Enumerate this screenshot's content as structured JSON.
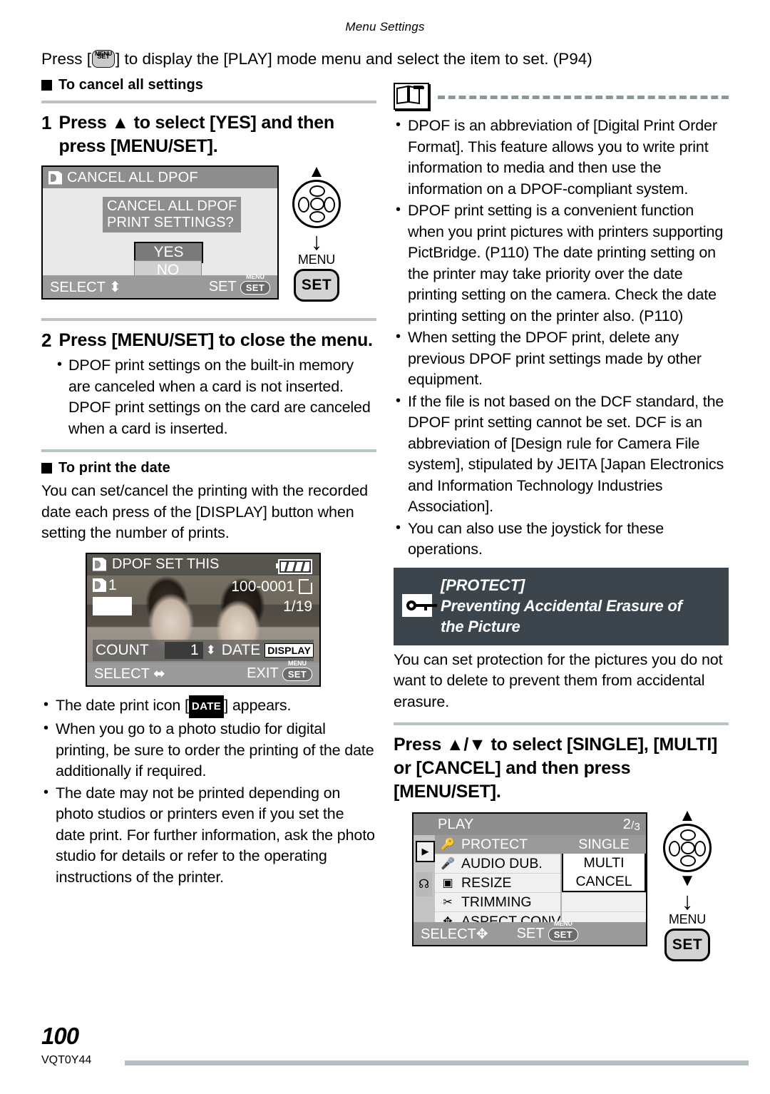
{
  "page": {
    "running_head": "Menu Settings",
    "page_number": "100",
    "doc_code": "VQT0Y44"
  },
  "intro": {
    "before": "Press [",
    "key_top": "MENU",
    "key_label": "SET",
    "after": "] to display the [PLAY] mode menu and select the item to set. (P94)"
  },
  "left": {
    "section1_heading": "To cancel all settings",
    "step1": {
      "number": "1",
      "text": "Press ▲ to select [YES] and then press [MENU/SET]."
    },
    "screen1": {
      "title": "CANCEL ALL DPOF",
      "message_line1": "CANCEL ALL DPOF",
      "message_line2": "PRINT SETTINGS?",
      "option_yes": "YES",
      "option_no": "NO",
      "bottom_left": "SELECT",
      "bottom_right": "SET",
      "set_chip_top": "MENU",
      "set_chip_label": "SET"
    },
    "cursor1": {
      "up_arrow": "▲",
      "menu_label": "MENU",
      "set_label": "SET"
    },
    "step2": {
      "number": "2",
      "text": "Press [MENU/SET] to close the menu.",
      "bullets": [
        "DPOF print settings on the built-in memory are canceled when a card is not inserted. DPOF print settings on the card are canceled when a card is inserted."
      ]
    },
    "section2_heading": "To print the date",
    "section2_body": "You can set/cancel the printing with the recorded date each press of the [DISPLAY] button when setting the number of prints.",
    "screen2": {
      "title": "DPOF SET THIS",
      "count_badge": "1",
      "file_number": "100-0001",
      "frame_counter": "1/19",
      "count_label": "COUNT",
      "count_value": "1",
      "date_label": "DATE",
      "display_chip": "DISPLAY",
      "bottom_left": "SELECT",
      "bottom_right": "EXIT",
      "set_chip_top": "MENU",
      "set_chip_label": "SET"
    },
    "bullets_after_screen2": [
      {
        "pre": "The date print icon [",
        "chip": "DATE",
        "post": "] appears."
      },
      {
        "pre": "When you go to a photo studio for digital printing, be sure to order the printing of the date additionally if required.",
        "chip": "",
        "post": ""
      },
      {
        "pre": "The date may not be printed depending on photo studios or printers even if you set the date print. For further information, ask the photo studio for details or refer to the operating instructions of the printer.",
        "chip": "",
        "post": ""
      }
    ]
  },
  "right": {
    "note_icon": "book-note-icon",
    "note_bullets": [
      "DPOF is an abbreviation of [Digital Print Order Format]. This feature allows you to write print information to media and then use the information on a DPOF-compliant system.",
      "DPOF print setting is a convenient function when you print pictures with printers supporting PictBridge. (P110) The date printing setting on the printer may take priority over the date printing setting on the camera. Check the date printing setting on the printer also. (P110)",
      "When setting the DPOF print, delete any previous DPOF print settings made by other equipment.",
      "If the file is not based on the DCF standard, the DPOF print setting cannot be set. DCF is an abbreviation of [Design rule for Camera File system], stipulated by JEITA [Japan Electronics and Information Technology Industries Association].",
      "You can also use the joystick for these operations."
    ],
    "banner": {
      "title": "[PROTECT]",
      "subtitle_line1": "Preventing Accidental Erasure of",
      "subtitle_line2": "the Picture",
      "icon": "key-icon",
      "bg_color": "#3b454b"
    },
    "banner_body": "You can set protection for the pictures you do not want to delete to prevent them from accidental erasure.",
    "step": {
      "text": "Press ▲/▼ to select [SINGLE], [MULTI] or [CANCEL] and then press [MENU/SET]."
    },
    "screen3": {
      "title": "PLAY",
      "page_indicator": "2/3",
      "page_num": "2",
      "page_den": "3",
      "rows": [
        {
          "icon": "key-icon",
          "label": "PROTECT",
          "selected": true
        },
        {
          "icon": "mic-icon",
          "label": "AUDIO DUB.",
          "selected": false
        },
        {
          "icon": "resize-icon",
          "label": "RESIZE",
          "selected": false
        },
        {
          "icon": "scissors-icon",
          "label": "TRIMMING",
          "selected": false
        },
        {
          "icon": "aspect-icon",
          "label": "ASPECT CONV.",
          "selected": false
        }
      ],
      "options": [
        {
          "label": "SINGLE",
          "selected": true
        },
        {
          "label": "MULTI",
          "selected": false
        },
        {
          "label": "CANCEL",
          "selected": false
        }
      ],
      "tab_play": "play-tab-icon",
      "tab_setup": "setup-tab-icon",
      "bottom_left": "SELECT",
      "bottom_right": "SET",
      "set_chip_top": "MENU",
      "set_chip_label": "SET"
    },
    "cursor2": {
      "up_arrow": "▲",
      "down_arrow": "▼",
      "menu_label": "MENU",
      "set_label": "SET"
    }
  }
}
